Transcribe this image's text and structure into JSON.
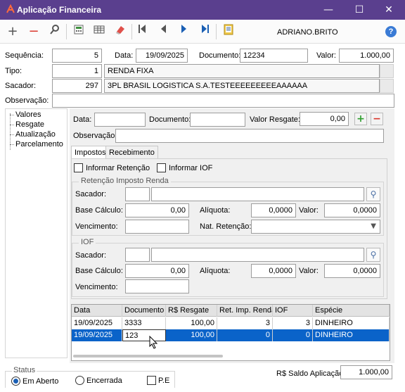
{
  "window": {
    "title": "Aplicação Financeira",
    "minimize": "—",
    "maximize": "☐",
    "close": "✕"
  },
  "toolbar": {
    "icons": [
      "add-icon",
      "remove-icon",
      "search-icon",
      "calculator-icon",
      "table-icon",
      "eraser-icon",
      "first-icon",
      "previous-icon",
      "next-icon",
      "last-icon",
      "report-icon",
      "help-icon"
    ],
    "user": "ADRIANO.BRITO"
  },
  "header": {
    "sequencia_label": "Sequência:",
    "sequencia_value": "5",
    "data_label": "Data:",
    "data_value": "19/09/2025",
    "documento_label": "Documento:",
    "documento_value": "12234",
    "valor_label": "Valor:",
    "valor_value": "1.000,00",
    "tipo_label": "Tipo:",
    "tipo_code": "1",
    "tipo_name": "RENDA FIXA",
    "sacador_label": "Sacador:",
    "sacador_code": "297",
    "sacador_name": "3PL BRASIL LOGISTICA S.A.TESTEEEEEEEEEAAAAAA",
    "observacao_label": "Observação:",
    "observacao_value": ""
  },
  "nav": {
    "items": [
      "Valores",
      "Resgate",
      "Atualização",
      "Parcelamento"
    ]
  },
  "resgate": {
    "data_label": "Data:",
    "data_value": "",
    "documento_label": "Documento:",
    "documento_value": "",
    "valor_label": "Valor Resgate:",
    "valor_value": "0,00",
    "observacao_label": "Observação:",
    "observacao_value": ""
  },
  "tabs": [
    "Impostos",
    "Recebimento"
  ],
  "options": {
    "informar_retencao": "Informar Retenção",
    "informar_iof": "Informar IOF"
  },
  "retencao": {
    "title": "Retenção Imposto Renda",
    "sacador_label": "Sacador:",
    "base_label": "Base Cálculo:",
    "base_value": "0,00",
    "aliquota_label": "Alíquota:",
    "aliquota_value": "0,0000",
    "valor_label": "Valor:",
    "valor_value": "0,0000",
    "vencimento_label": "Vencimento:",
    "nat_label": "Nat. Retenção:"
  },
  "iof": {
    "title": "IOF",
    "sacador_label": "Sacador:",
    "base_label": "Base Cálculo:",
    "base_value": "0,00",
    "aliquota_label": "Alíquota:",
    "aliquota_value": "0,0000",
    "valor_label": "Valor:",
    "valor_value": "0,0000",
    "vencimento_label": "Vencimento:"
  },
  "grid": {
    "columns": [
      "Data",
      "Documento",
      "R$ Resgate",
      "Ret. Imp. Renda",
      "IOF",
      "Espécie"
    ],
    "rows": [
      [
        "19/09/2025",
        "3333",
        "100,00",
        "3",
        "3",
        "DINHEIRO"
      ],
      [
        "19/09/2025",
        "123",
        "100,00",
        "0",
        "0",
        "DINHEIRO"
      ]
    ]
  },
  "status": {
    "title": "Status",
    "em_aberto": "Em Aberto",
    "encerrada": "Encerrada",
    "pe": "P.E",
    "saldo_label": "R$ Saldo Aplicação:",
    "saldo_value": "1.000,00"
  },
  "colors": {
    "titlebar": "#5a3f8e",
    "selection": "#0a63c9",
    "add_green": "#2e9e2e",
    "remove_red": "#d9362b"
  }
}
